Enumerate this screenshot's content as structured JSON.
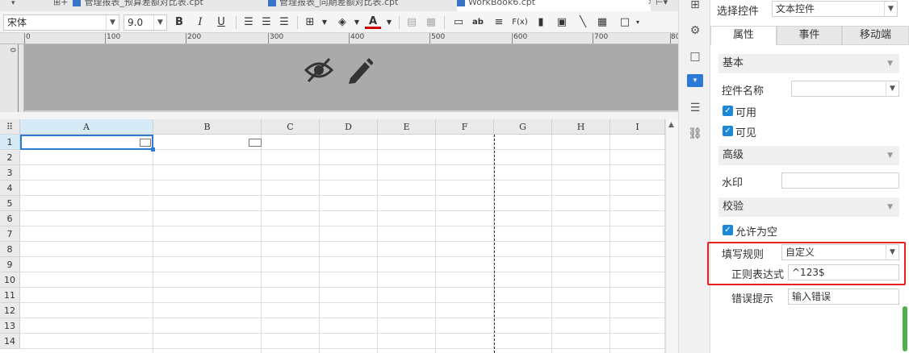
{
  "tabs": [
    {
      "label": "管理报表_预算差额对比表.cpt"
    },
    {
      "label": "管理报表_同期差额对比表.cpt"
    },
    {
      "label": "WorkBook6.cpt"
    }
  ],
  "toolbar": {
    "font_family": "宋体",
    "font_size": "9.0",
    "bold": "B",
    "italic": "I",
    "underline": "U",
    "text_color": "A",
    "ab_label": "ab",
    "fx_label": "F(x)"
  },
  "ruler": {
    "marks": [
      "0",
      "100",
      "200",
      "300",
      "400",
      "500",
      "600",
      "700",
      "80"
    ],
    "vmark": "0"
  },
  "grid": {
    "columns": [
      "A",
      "B",
      "C",
      "D",
      "E",
      "F",
      "G",
      "H",
      "I"
    ],
    "rows": [
      "1",
      "2",
      "3",
      "4",
      "5",
      "6",
      "7",
      "8",
      "9",
      "10",
      "11",
      "12",
      "13",
      "14"
    ],
    "selected_cell": "A1"
  },
  "panel": {
    "select_widget_label": "选择控件",
    "select_widget_value": "文本控件",
    "tabs": [
      "属性",
      "事件",
      "移动端"
    ],
    "active_tab": "属性",
    "basic": {
      "title": "基本",
      "name_label": "控件名称",
      "name_value": "",
      "enabled_label": "可用",
      "visible_label": "可见"
    },
    "advanced": {
      "title": "高级",
      "watermark_label": "水印",
      "watermark_value": ""
    },
    "validation": {
      "title": "校验",
      "allow_empty_label": "允许为空",
      "rule_label": "填写规则",
      "rule_value": "自定义",
      "regex_label": "正则表达式",
      "regex_value": "^123$",
      "error_label": "错误提示",
      "error_value": "输入错误"
    }
  },
  "colors": {
    "accent": "#1e88d8",
    "highlight": "#e62222",
    "selection": "#d6eaf8"
  }
}
